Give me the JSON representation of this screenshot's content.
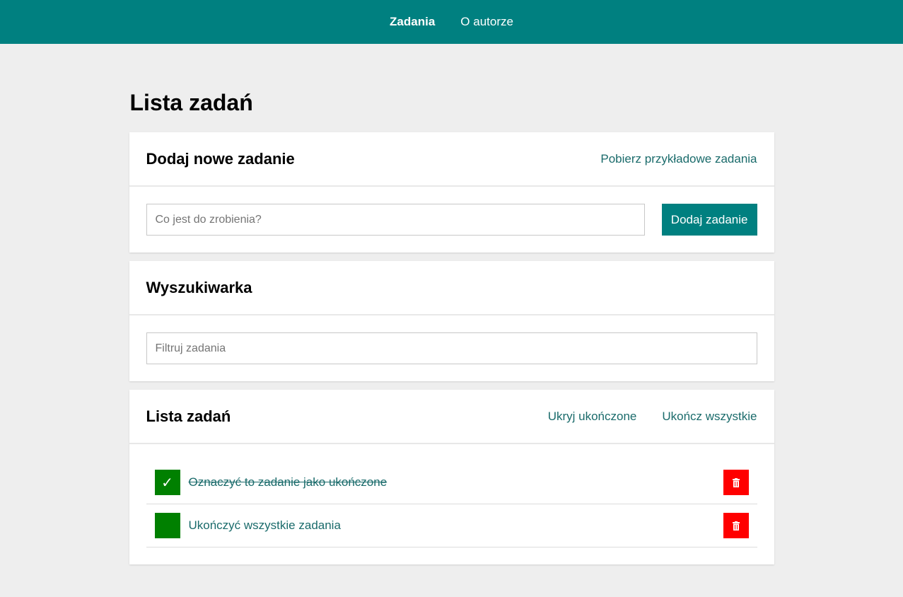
{
  "nav": {
    "items": [
      {
        "label": "Zadania",
        "active": true
      },
      {
        "label": "O autorze",
        "active": false
      }
    ]
  },
  "page": {
    "title": "Lista zadań"
  },
  "add_section": {
    "title": "Dodaj nowe zadanie",
    "fetch_link": "Pobierz przykładowe zadania",
    "input_placeholder": "Co jest do zrobienia?",
    "input_value": "",
    "button_label": "Dodaj zadanie"
  },
  "search_section": {
    "title": "Wyszukiwarka",
    "input_placeholder": "Filtruj zadania",
    "input_value": ""
  },
  "list_section": {
    "title": "Lista zadań",
    "hide_done_link": "Ukryj ukończone",
    "complete_all_link": "Ukończ wszystkie",
    "tasks": [
      {
        "text": "Oznaczyć to zadanie jako ukończone",
        "done": true,
        "check_glyph": "✓"
      },
      {
        "text": "Ukończyć wszystkie zadania",
        "done": false,
        "check_glyph": ""
      }
    ]
  },
  "icons": {
    "checkbox": "check-icon",
    "delete": "trash-icon"
  },
  "colors": {
    "primary": "#008080",
    "background": "#eeeeee",
    "link": "#1a6b6b",
    "checkbox": "#008000",
    "delete": "#ff0000"
  }
}
